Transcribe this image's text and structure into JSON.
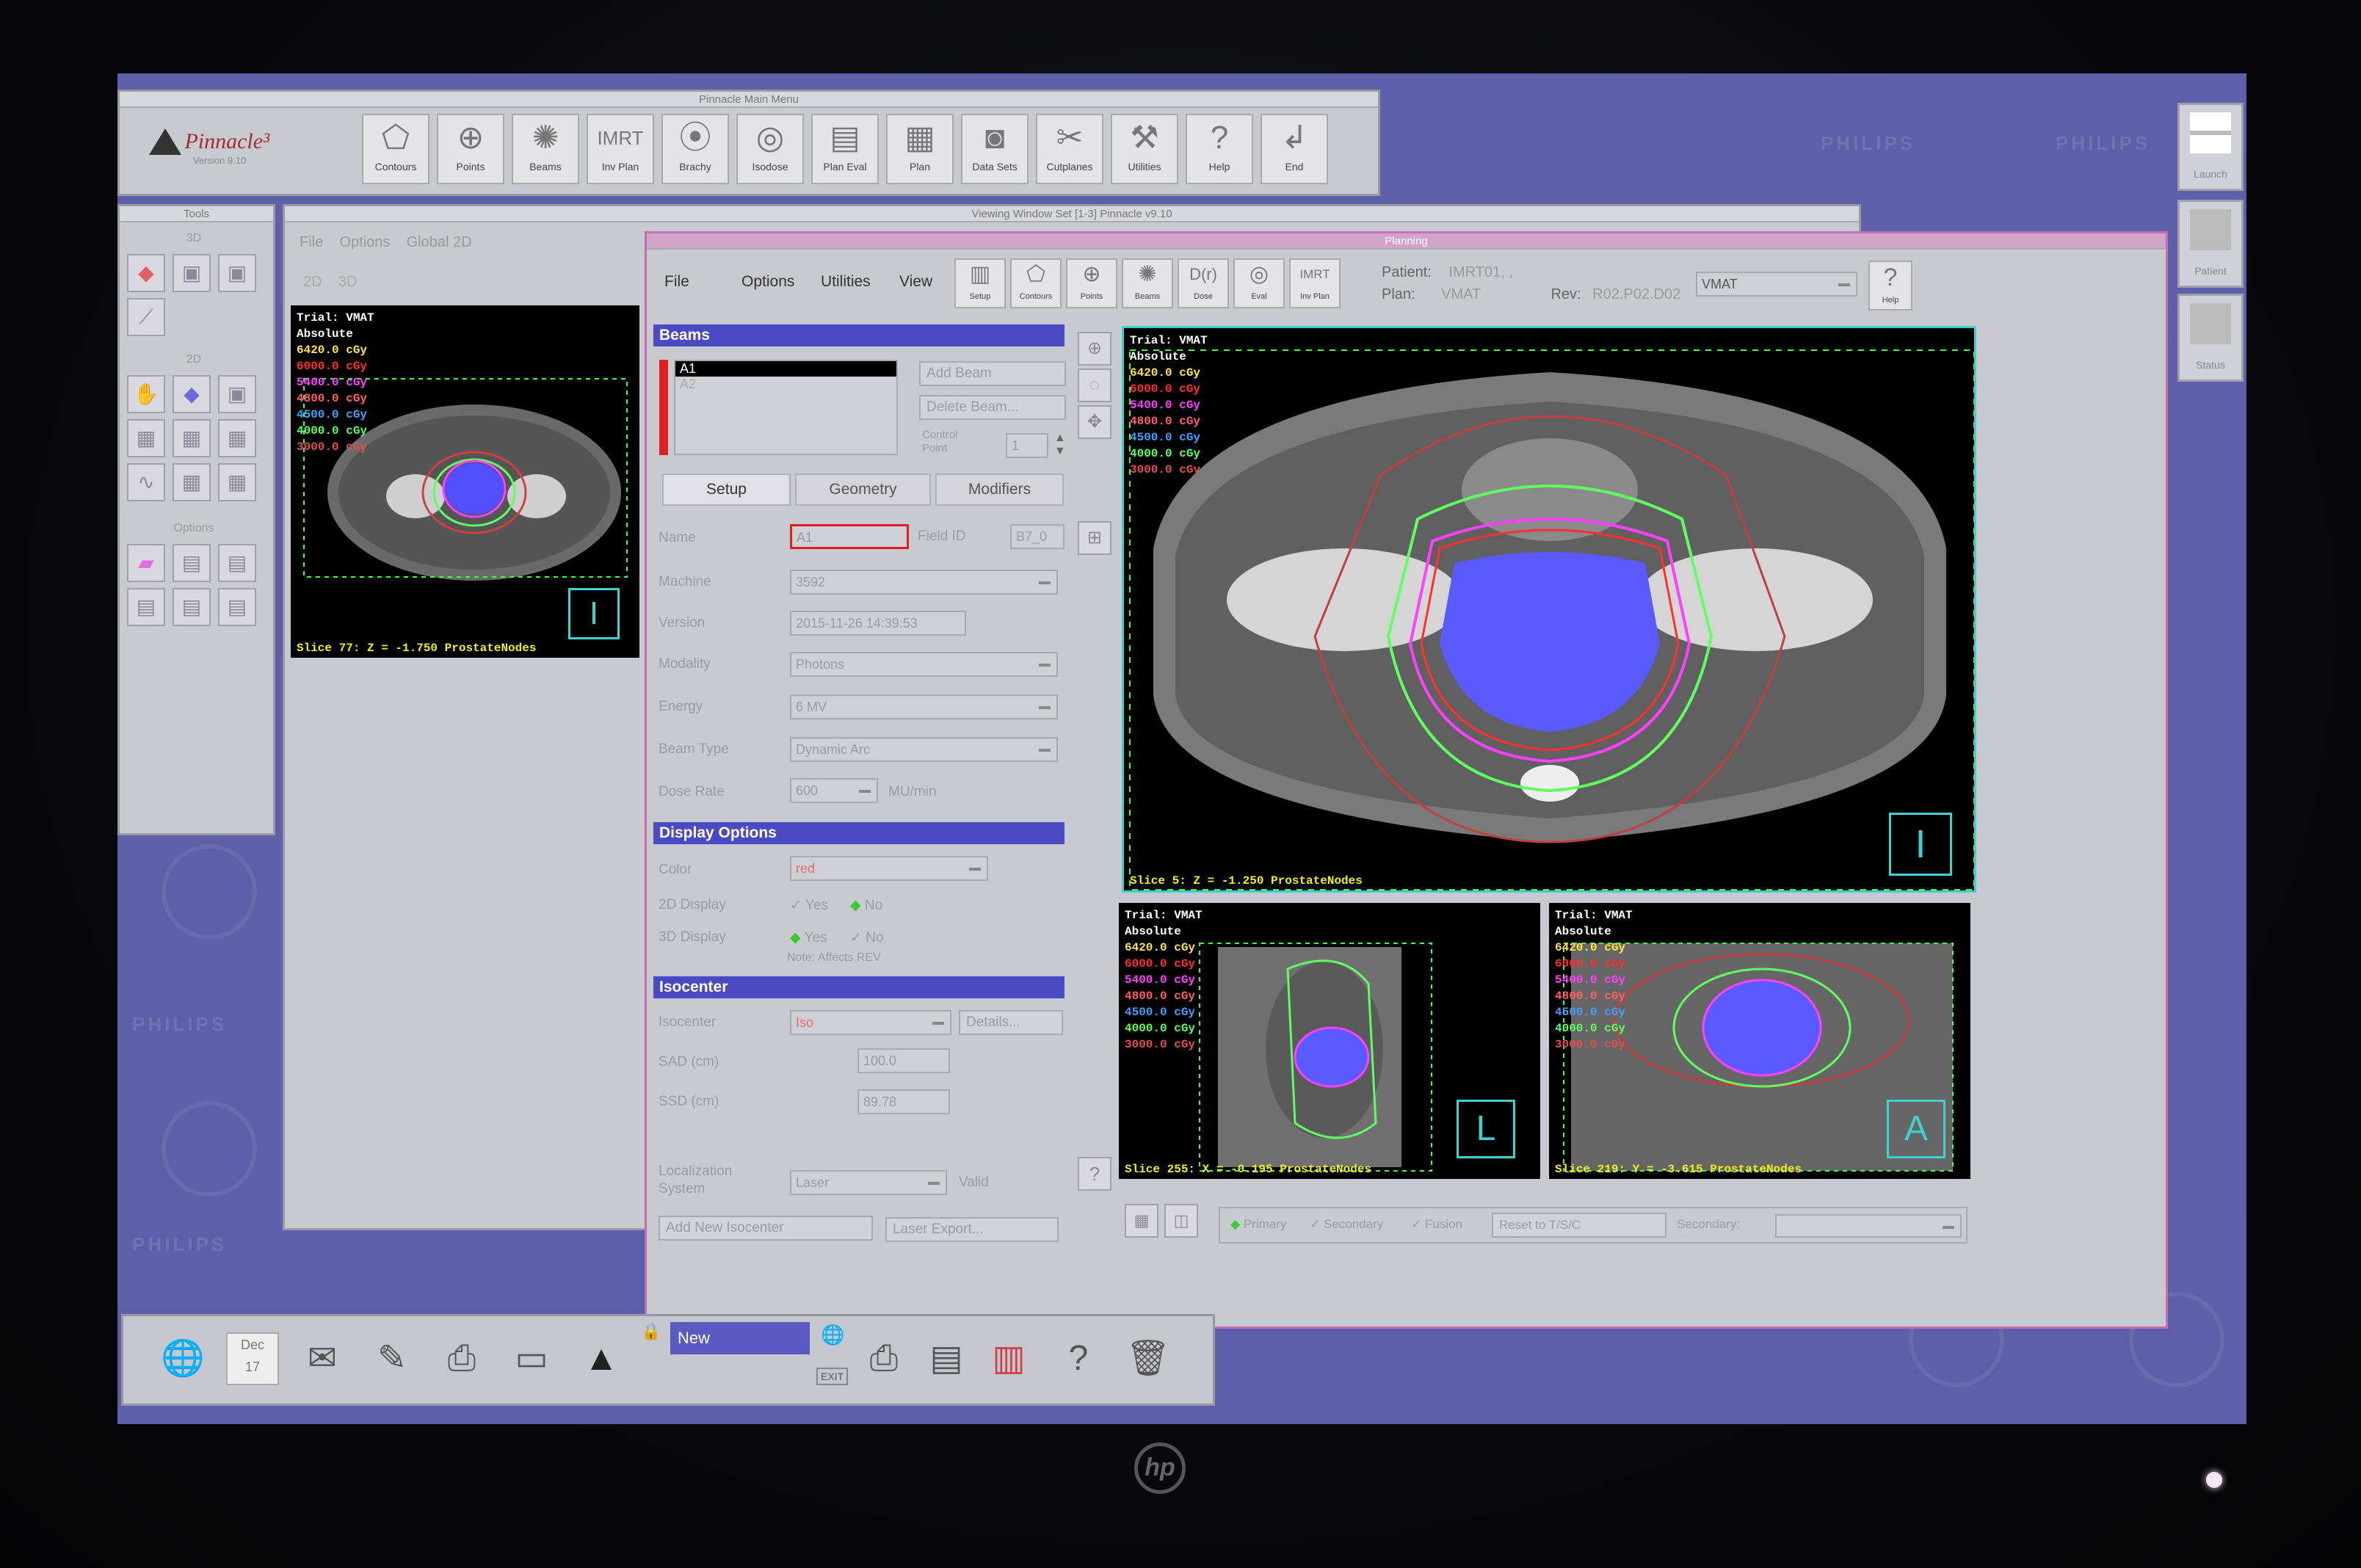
{
  "desktop": {
    "tile_text": "PHILIPS"
  },
  "main_menu": {
    "title": "Pinnacle Main Menu",
    "logo": "Pinnacle³",
    "version": "Version 9.10",
    "tools": [
      {
        "label": "Contours",
        "icon": "contours-icon"
      },
      {
        "label": "Points",
        "icon": "points-icon"
      },
      {
        "label": "Beams",
        "icon": "beams-icon"
      },
      {
        "label": "Inv Plan",
        "icon": "imrt-icon"
      },
      {
        "label": "Brachy",
        "icon": "brachy-icon"
      },
      {
        "label": "Isodose",
        "icon": "isodose-icon"
      },
      {
        "label": "Plan Eval",
        "icon": "plan-eval-icon"
      },
      {
        "label": "Plan",
        "icon": "plan-icon"
      },
      {
        "label": "Data Sets",
        "icon": "data-sets-icon"
      },
      {
        "label": "Cutplanes",
        "icon": "cutplanes-icon"
      },
      {
        "label": "Utilities",
        "icon": "utilities-icon"
      },
      {
        "label": "Help",
        "icon": "help-icon"
      },
      {
        "label": "End",
        "icon": "end-icon"
      }
    ]
  },
  "tools_palette": {
    "title": "Tools",
    "sections": [
      "3D",
      "2D",
      "Options"
    ]
  },
  "viewing_window": {
    "title": "Viewing Window Set [1-3]      Pinnacle v9.10",
    "menu": [
      "File",
      "Options",
      "Global 2D"
    ],
    "tabs": [
      "2D",
      "3D"
    ],
    "legend": {
      "trial": "Trial: VMAT",
      "mode": "Absolute",
      "doses": [
        "6420.0 cGy",
        "6000.0 cGy",
        "5400.0 cGy",
        "4800.0 cGy",
        "4500.0 cGy",
        "4000.0 cGy",
        "3000.0 cGy"
      ]
    },
    "slice": "Slice 77: Z = -1.750 ProstateNodes"
  },
  "planning": {
    "title": "Planning",
    "menu": [
      "File",
      "Options",
      "Utilities",
      "View"
    ],
    "toolbar": [
      "Setup",
      "Contours",
      "Points",
      "Beams",
      "Dose",
      "Eval",
      "Inv Plan"
    ],
    "patient_label": "Patient:",
    "patient": "IMRT01, ,",
    "plan_label": "Plan:",
    "plan": "VMAT",
    "rev_label": "Rev:",
    "rev": "R02.P02.D02",
    "trial_select": "VMAT",
    "help_label": "Help",
    "beams": {
      "header": "Beams",
      "list": [
        "A1",
        "A2"
      ],
      "add_beam": "Add Beam",
      "delete_beam": "Delete Beam...",
      "control_point_label": "Control Point",
      "control_point": "1",
      "tabs": [
        "Setup",
        "Geometry",
        "Modifiers"
      ],
      "fields": {
        "name_label": "Name",
        "name": "A1",
        "field_id_label": "Field ID",
        "field_id": "B7_0",
        "machine_label": "Machine",
        "machine": "3592",
        "version_label": "Version",
        "version": "2015-11-26 14:39:53",
        "modality_label": "Modality",
        "modality": "Photons",
        "energy_label": "Energy",
        "energy": "6 MV",
        "beam_type_label": "Beam Type",
        "beam_type": "Dynamic Arc",
        "dose_rate_label": "Dose Rate",
        "dose_rate": "600",
        "dose_rate_unit": "MU/min"
      }
    },
    "display_options": {
      "header": "Display Options",
      "color_label": "Color",
      "color": "red",
      "display_2d_label": "2D Display",
      "display_3d_label": "3D Display",
      "yes": "Yes",
      "no": "No",
      "note": "Note: Affects REV"
    },
    "isocenter": {
      "header": "Isocenter",
      "isocenter_label": "Isocenter",
      "isocenter": "Iso",
      "details": "Details...",
      "sad_label": "SAD (cm)",
      "sad": "100.0",
      "ssd_label": "SSD (cm)",
      "ssd": "89.78",
      "localization_label": "Localization System",
      "localization": "Laser",
      "valid": "Valid",
      "add_new": "Add New Isocenter",
      "laser_export": "Laser Export..."
    },
    "views": {
      "axial_slice": "Slice 5: Z = -1.250 ProstateNodes",
      "sagittal_slice": "Slice 255: X = -0.195 ProstateNodes",
      "coronal_slice": "Slice 219: Y = -3.615 ProstateNodes"
    },
    "bottom_bar": {
      "primary": "Primary",
      "secondary": "Secondary",
      "fusion": "Fusion",
      "reset": "Reset to T/S/C",
      "secondary_label": "Secondary:"
    }
  },
  "side_buttons": [
    "Launch",
    "Patient",
    "Status"
  ],
  "taskbar": {
    "new_label": "New",
    "exit_label": "EXIT",
    "calendar_month": "Dec",
    "calendar_day": "17"
  },
  "colors": {
    "dose_6420": "#ffe640",
    "dose_6000": "#ff3030",
    "dose_5400": "#ff40ff",
    "dose_4800": "#ff6060",
    "dose_4500": "#40a0ff",
    "dose_4000": "#60ff60",
    "dose_3000": "#e05050",
    "accent": "#4a4ac2",
    "desktop": "#5d5fa8"
  }
}
